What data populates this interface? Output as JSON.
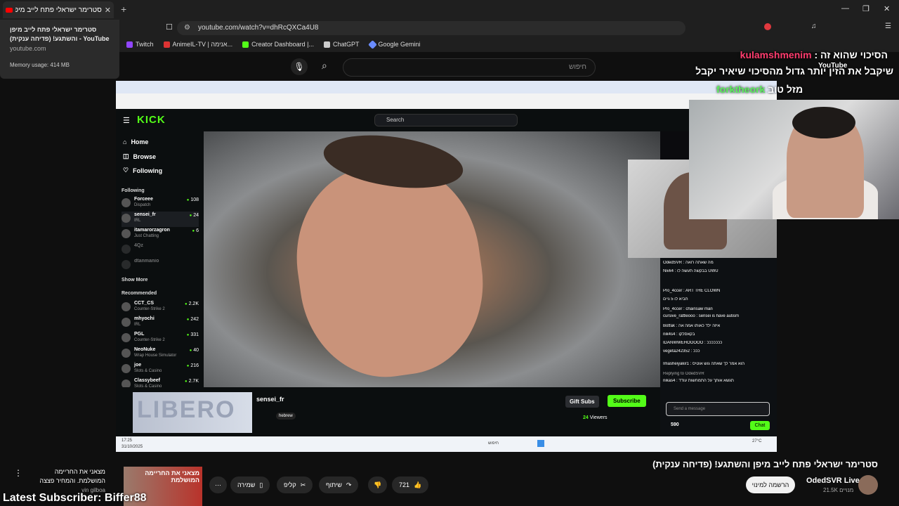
{
  "browser": {
    "tab_title": "סטרימר ישראלי פתח לייב מיפן ו",
    "url": "youtube.com/watch?v=dhRcQXCa4U8",
    "bookmarks": [
      "Twitch",
      "AnimeIL-TV | אנימה...",
      "Creator Dashboard |...",
      "ChatGPT",
      "Google Gemini"
    ],
    "tooltip": {
      "title": "סטרימר ישראלי פתח לייב מיפן YouTube - והשתגע! (פדיחה ענקית)",
      "domain": "youtube.com",
      "memory": "Memory usage: 414 MB"
    }
  },
  "youtube": {
    "search_placeholder": "חיפוש",
    "video_title": "סטרימר ישראלי פתח לייב מיפן והשתגע! (פדיחה ענקית)",
    "channel_name": "OdedSVR Live",
    "channel_subs": "21.5K מנויים",
    "subscribe_label": "הרשמה למינוי",
    "like_count": "721",
    "share_label": "שיתוף",
    "clip_label": "קליפ",
    "save_label": "שמירה",
    "promo_text": "מצאני את החריימה המושלמת. והמחיר פצצה",
    "promo_channel": "vin gilboa",
    "promo_thumb_text": "מצאני את החריימה המושלמת"
  },
  "overlay": {
    "chat_line1_user": "kulamshmenim",
    "chat_line1_pre": "הסיכוי שהוא זה :",
    "chat_line2": "שיקבל את הזין יותר גדול מהסיכוי שיאיר יקבל",
    "chat_line3_user": "forktheork",
    "chat_line3_text": "מזל טוב",
    "latest_subscriber": "Latest Subscriber: Biffer88",
    "yt_badge": "YouTube"
  },
  "kick": {
    "search": "Search",
    "nav": [
      "Home",
      "Browse",
      "Following"
    ],
    "following_label": "Following",
    "show_more": "Show More",
    "recommended_label": "Recommended",
    "following_channels": [
      {
        "name": "Forceee",
        "cat": "Dispatch",
        "viewers": "108"
      },
      {
        "name": "sensei_fr",
        "cat": "IRL",
        "viewers": "24"
      },
      {
        "name": "itamarorzagron",
        "cat": "Just Chatting",
        "viewers": "6"
      },
      {
        "name": "4Qz",
        "cat": "",
        "viewers": ""
      },
      {
        "name": "dtanmanio",
        "cat": "",
        "viewers": ""
      }
    ],
    "recommended_channels": [
      {
        "name": "CCT_CS",
        "cat": "Counter-Strike 2",
        "viewers": "2.2K"
      },
      {
        "name": "mhyochi",
        "cat": "IRL",
        "viewers": "242"
      },
      {
        "name": "PGL",
        "cat": "Counter-Strike 2",
        "viewers": "331"
      },
      {
        "name": "NeoNuke",
        "cat": "Wrap House Simulator",
        "viewers": "40"
      },
      {
        "name": "joe",
        "cat": "Slots & Casino",
        "viewers": "216"
      },
      {
        "name": "Classybeef",
        "cat": "Slots & Casino",
        "viewers": "2.7K"
      }
    ],
    "streamer": "sensei_fr",
    "tag": "hebrew",
    "gift_subs": "Gift Subs",
    "subscribe": "Subscribe",
    "viewers": "24",
    "viewers_label": "Viewers",
    "chat_placeholder": "Send a message",
    "chat_button": "Chat",
    "points": "590",
    "chat": [
      "OdedSVR : מה שאתה רואה",
      "Nivk4 : בבקשה תעשה לו UWU",
      "Pro_4ccer : ART THE CLOWN",
      "חביא לו 5 גיים",
      "Pro_4ccer : chainsaw man",
      "cursive_rattleooo : sensei is have autism",
      "Botfak : איזה ילד כאותו אמה אה",
      "nik4s4 : בקאסלקו",
      "IDANWWEHOOOOO : כככככככ",
      "vegeta242352 : כככ",
      "Imasheiyakir1 : הוא אמר לך שאתה גוש אוטיס",
      "Replying to OdedSVR",
      "nikas4 : תגשא אותך על התמחשות עודד"
    ],
    "taskbar_time": "17:25",
    "taskbar_date": "31/10/2025",
    "taskbar_search": "חיפוש",
    "taskbar_weather": "27°C"
  }
}
